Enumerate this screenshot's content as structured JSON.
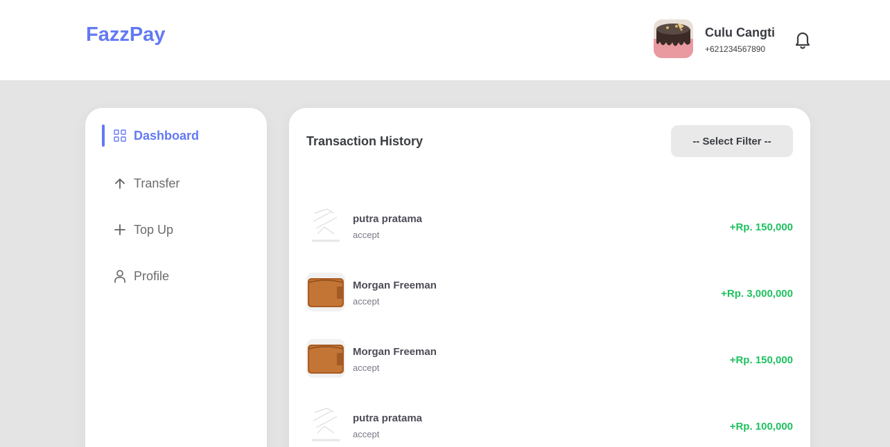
{
  "header": {
    "logo": "FazzPay",
    "user_name": "Culu Cangti",
    "user_phone": "+621234567890",
    "bell_icon": "bell-icon"
  },
  "sidebar": {
    "items": [
      {
        "label": "Dashboard",
        "icon": "grid-icon",
        "active": true
      },
      {
        "label": "Transfer",
        "icon": "arrow-up-icon",
        "active": false
      },
      {
        "label": "Top Up",
        "icon": "plus-icon",
        "active": false
      },
      {
        "label": "Profile",
        "icon": "user-icon",
        "active": false
      }
    ]
  },
  "main": {
    "title": "Transaction History",
    "filter_label": "-- Select Filter --",
    "transactions": [
      {
        "name": "putra pratama",
        "status": "accept",
        "amount": "+Rp. 150,000",
        "image": "logo-placeholder"
      },
      {
        "name": "Morgan Freeman",
        "status": "accept",
        "amount": "+Rp. 3,000,000",
        "image": "wallet"
      },
      {
        "name": "Morgan Freeman",
        "status": "accept",
        "amount": "+Rp. 150,000",
        "image": "wallet"
      },
      {
        "name": "putra pratama",
        "status": "accept",
        "amount": "+Rp. 100,000",
        "image": "logo-placeholder"
      }
    ]
  },
  "colors": {
    "primary": "#6379f4",
    "income": "#1ec15f",
    "background": "#e4e4e4"
  }
}
